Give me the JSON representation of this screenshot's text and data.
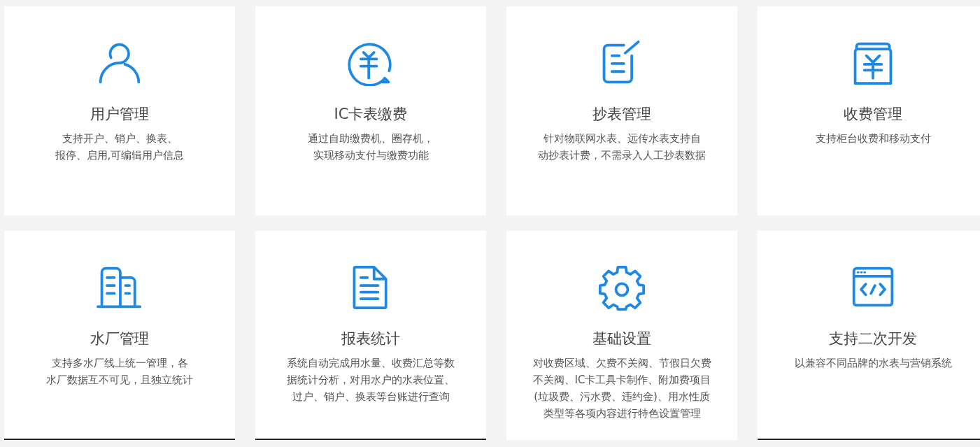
{
  "cards": [
    {
      "kind": "person",
      "title": "用户管理",
      "lines": [
        "支持开户、销户、换表、",
        "报停、启用,可编辑用户信息"
      ],
      "underlined": false
    },
    {
      "kind": "yen-bubble",
      "title": "IC卡表缴费",
      "lines": [
        "通过自助缴费机、圈存机，",
        "实现移动支付与缴费功能"
      ],
      "underlined": false
    },
    {
      "kind": "note-pen",
      "title": "抄表管理",
      "lines": [
        "针对物联网水表、远传水表支持自",
        "动抄表计费，不需录入人工抄表数据"
      ],
      "underlined": false
    },
    {
      "kind": "yen-box",
      "title": "收费管理",
      "lines": [
        "支持柜台收费和移动支付"
      ],
      "underlined": false
    },
    {
      "kind": "building",
      "title": "水厂管理",
      "lines": [
        "支持多水厂线上统一管理，各",
        "水厂数据互不可见，且独立统计"
      ],
      "underlined": true
    },
    {
      "kind": "document",
      "title": "报表统计",
      "lines": [
        "系统自动完成用水量、收费汇总等数",
        "据统计分析，对用水户的水表位置、",
        "过户、销户、换表等台账进行查询"
      ],
      "underlined": true
    },
    {
      "kind": "gear",
      "title": "基础设置",
      "lines": [
        "对收费区域、欠费不关阀、节假日欠费",
        "不关阀、IC卡工具卡制作、附加费项目",
        "(垃圾费、污水费、违约金)、用水性质",
        "类型等各项内容进行特色设置管理"
      ],
      "underlined": false
    },
    {
      "kind": "code-window",
      "title": "支持二次开发",
      "lines": [
        "以兼容不同品牌的水表与营销系统"
      ],
      "underlined": true
    }
  ]
}
